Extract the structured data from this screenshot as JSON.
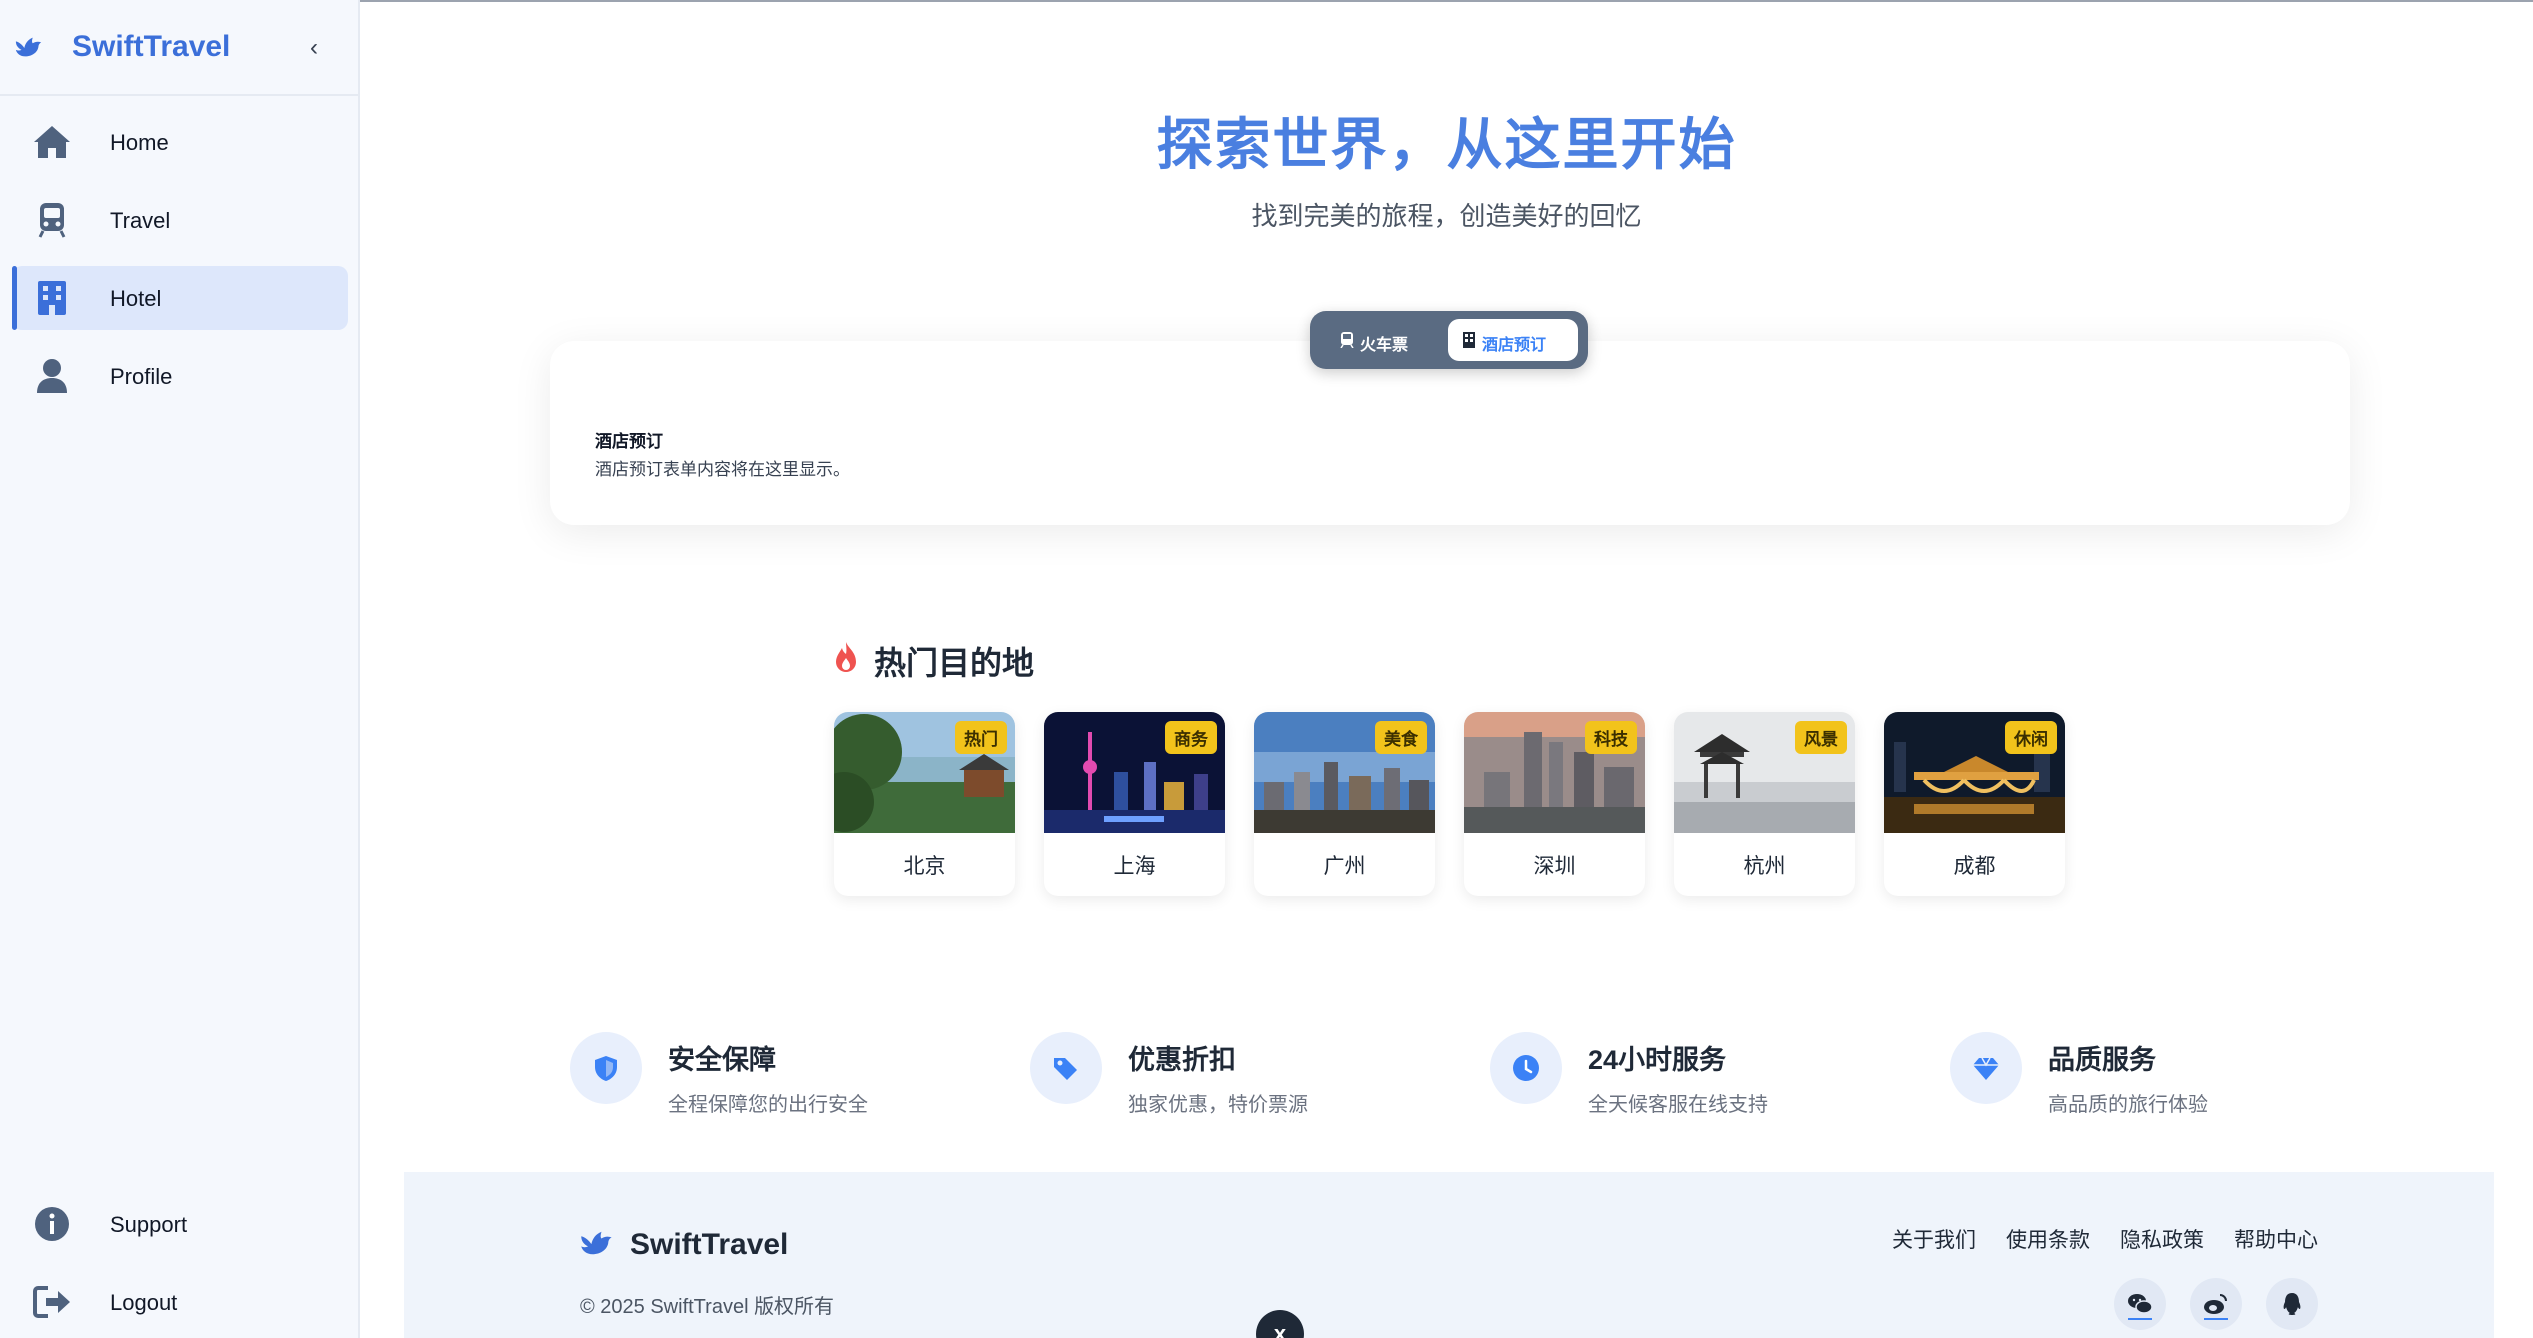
{
  "app": {
    "name": "SwiftTravel",
    "collapse_icon": "chevron-left-icon"
  },
  "sidebar": {
    "items": [
      {
        "label": "Home",
        "icon": "home-icon",
        "active": false
      },
      {
        "label": "Travel",
        "icon": "train-icon",
        "active": false
      },
      {
        "label": "Hotel",
        "icon": "hotel-icon",
        "active": true
      },
      {
        "label": "Profile",
        "icon": "user-icon",
        "active": false
      }
    ],
    "bottom": [
      {
        "label": "Support",
        "icon": "info-icon"
      },
      {
        "label": "Logout",
        "icon": "logout-icon"
      }
    ]
  },
  "hero": {
    "title": "探索世界，从这里开始",
    "subtitle": "找到完美的旅程，创造美好的回忆"
  },
  "tabs": [
    {
      "label": "火车票",
      "icon": "train-icon",
      "active": false
    },
    {
      "label": "酒店预订",
      "icon": "hotel-icon",
      "active": true
    }
  ],
  "booking": {
    "title": "酒店预订",
    "description": "酒店预订表单内容将在这里显示。"
  },
  "destinations": {
    "title": "热门目的地",
    "icon": "flame-icon",
    "items": [
      {
        "name": "北京",
        "tag": "热门"
      },
      {
        "name": "上海",
        "tag": "商务"
      },
      {
        "name": "广州",
        "tag": "美食"
      },
      {
        "name": "深圳",
        "tag": "科技"
      },
      {
        "name": "杭州",
        "tag": "风景"
      },
      {
        "name": "成都",
        "tag": "休闲"
      }
    ]
  },
  "features": [
    {
      "title": "安全保障",
      "desc": "全程保障您的出行安全",
      "icon": "shield-icon"
    },
    {
      "title": "优惠折扣",
      "desc": "独家优惠，特价票源",
      "icon": "tags-icon"
    },
    {
      "title": "24小时服务",
      "desc": "全天候客服在线支持",
      "icon": "clock-icon"
    },
    {
      "title": "品质服务",
      "desc": "高品质的旅行体验",
      "icon": "diamond-icon"
    }
  ],
  "footer": {
    "brand": "SwiftTravel",
    "copyright": "© 2025 SwiftTravel 版权所有",
    "links": [
      "关于我们",
      "使用条款",
      "隐私政策",
      "帮助中心"
    ],
    "social": [
      "wechat-icon",
      "weibo-icon",
      "qq-icon"
    ]
  },
  "colors": {
    "accent": "#3b6fd9",
    "badge": "#f2c31b",
    "sidebar_bg": "#f5f8fd"
  }
}
